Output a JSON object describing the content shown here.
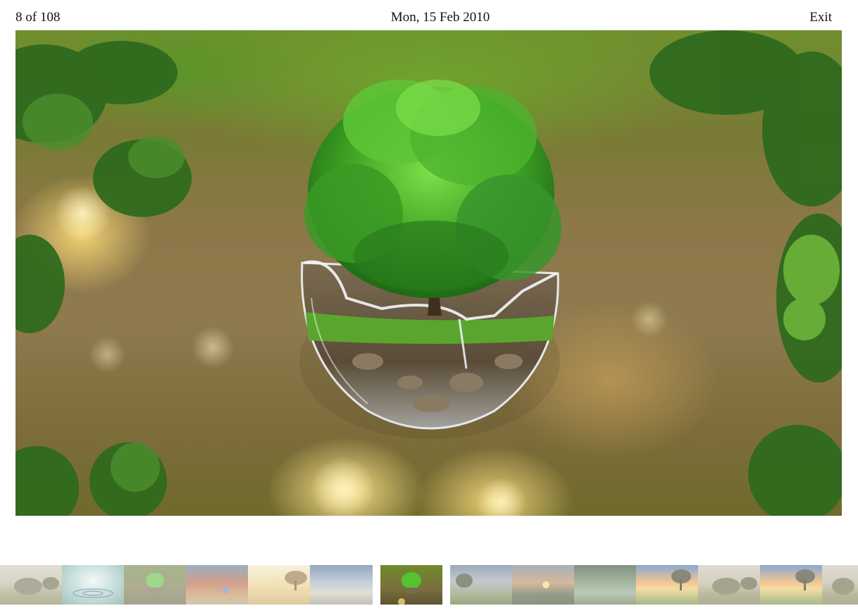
{
  "header": {
    "counter": "8 of 108",
    "date": "Mon, 15 Feb 2010",
    "exit_label": "Exit"
  },
  "photo": {
    "subject": "tree growing in broken glass sphere"
  },
  "filmstrip": {
    "left_thumbs": [
      {
        "name": "thumb-countryside-trees"
      },
      {
        "name": "thumb-water-ripple"
      },
      {
        "name": "thumb-tree-sphere"
      },
      {
        "name": "thumb-autumn-field"
      },
      {
        "name": "thumb-sunset-tree"
      },
      {
        "name": "thumb-coastal-dunes"
      }
    ],
    "current_thumb": {
      "name": "thumb-current-tree-sphere"
    },
    "right_thumbs": [
      {
        "name": "thumb-stormy-field"
      },
      {
        "name": "thumb-sunset-hills"
      },
      {
        "name": "thumb-misty-forest"
      },
      {
        "name": "thumb-sunset-tree-lake"
      },
      {
        "name": "thumb-countryside-trees-2"
      },
      {
        "name": "thumb-sunset-tree-lake-2"
      },
      {
        "name": "thumb-countryside-trees-3"
      }
    ]
  }
}
